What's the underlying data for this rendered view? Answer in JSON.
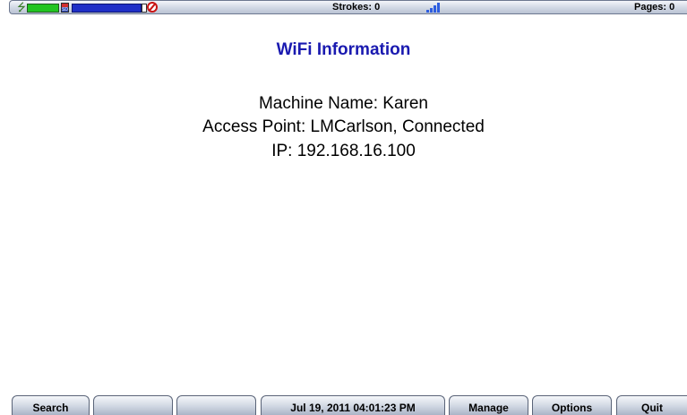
{
  "status_bar": {
    "strokes": "Strokes: 0",
    "pages": "Pages: 0",
    "icons": [
      "power-plug-icon",
      "battery-icon",
      "sd-card-icon",
      "storage-bar-icon",
      "no-symbol-icon",
      "wifi-signal-icon"
    ],
    "colors": {
      "battery": "#22c422",
      "storage": "#1f2fc7",
      "no_symbol": "#c81414",
      "signal": "#2d5de0"
    }
  },
  "main": {
    "title": "WiFi Information",
    "machine_name": "Machine Name: Karen",
    "access_point": "Access Point: LMCarlson, Connected",
    "ip": "IP: 192.168.16.100",
    "title_color": "#1a1ab0"
  },
  "softkeys": {
    "k1": "Search",
    "k2": "",
    "k3": "",
    "k4": "Jul 19, 2011  04:01:23 PM",
    "k5": "Manage",
    "k6": "Options",
    "k7": "Quit"
  }
}
